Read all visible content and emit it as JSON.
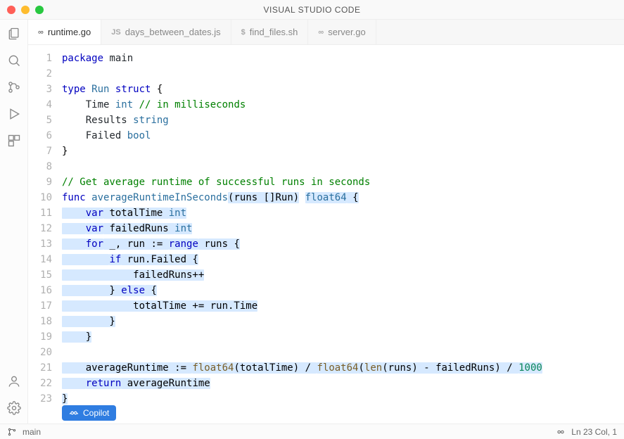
{
  "title": "VISUAL STUDIO CODE",
  "tabs": [
    {
      "icon": "go",
      "label": "runtime.go",
      "active": true
    },
    {
      "icon": "js",
      "label": "days_between_dates.js",
      "active": false
    },
    {
      "icon": "sh",
      "label": "find_files.sh",
      "active": false
    },
    {
      "icon": "go",
      "label": "server.go",
      "active": false
    }
  ],
  "tab_icon_text": {
    "go": "∞",
    "js": "JS",
    "sh": "$"
  },
  "code": {
    "lines": 23,
    "content": [
      {
        "n": 1,
        "tokens": [
          {
            "t": "package",
            "c": "k"
          },
          {
            "t": " "
          },
          {
            "t": "main",
            "c": "ident"
          }
        ]
      },
      {
        "n": 2,
        "tokens": []
      },
      {
        "n": 3,
        "tokens": [
          {
            "t": "type",
            "c": "k"
          },
          {
            "t": " "
          },
          {
            "t": "Run",
            "c": "t"
          },
          {
            "t": " "
          },
          {
            "t": "struct",
            "c": "k"
          },
          {
            "t": " {"
          }
        ]
      },
      {
        "n": 4,
        "tokens": [
          {
            "t": "    "
          },
          {
            "t": "Time ",
            "c": "ident"
          },
          {
            "t": "int",
            "c": "t"
          },
          {
            "t": " "
          },
          {
            "t": "// in milliseconds",
            "c": "c"
          }
        ]
      },
      {
        "n": 5,
        "tokens": [
          {
            "t": "    "
          },
          {
            "t": "Results ",
            "c": "ident"
          },
          {
            "t": "string",
            "c": "t"
          }
        ]
      },
      {
        "n": 6,
        "tokens": [
          {
            "t": "    "
          },
          {
            "t": "Failed ",
            "c": "ident"
          },
          {
            "t": "bool",
            "c": "t"
          }
        ]
      },
      {
        "n": 7,
        "tokens": [
          {
            "t": "}"
          }
        ]
      },
      {
        "n": 8,
        "tokens": []
      },
      {
        "n": 9,
        "tokens": [
          {
            "t": "// Get average runtime of successful runs in seconds",
            "c": "c"
          }
        ]
      },
      {
        "n": 10,
        "tokens": [
          {
            "t": "func",
            "c": "k"
          },
          {
            "t": " "
          },
          {
            "t": "averageRuntimeInSeconds",
            "c": "fn"
          },
          {
            "t": "(runs []Run)",
            "h": true
          },
          {
            "t": " "
          },
          {
            "t": "float64",
            "c": "t",
            "h": true
          },
          {
            "t": " {",
            "h": true
          }
        ]
      },
      {
        "n": 11,
        "tokens": [
          {
            "t": "    ",
            "h": true
          },
          {
            "t": "var",
            "c": "k",
            "h": true
          },
          {
            "t": " totalTime ",
            "h": true
          },
          {
            "t": "int",
            "c": "t",
            "h": true
          }
        ]
      },
      {
        "n": 12,
        "tokens": [
          {
            "t": "    ",
            "h": true
          },
          {
            "t": "var",
            "c": "k",
            "h": true
          },
          {
            "t": " failedRuns ",
            "h": true
          },
          {
            "t": "int",
            "c": "t",
            "h": true
          }
        ]
      },
      {
        "n": 13,
        "tokens": [
          {
            "t": "    ",
            "h": true
          },
          {
            "t": "for",
            "c": "k",
            "h": true
          },
          {
            "t": " _, run := ",
            "h": true
          },
          {
            "t": "range",
            "c": "k",
            "h": true
          },
          {
            "t": " runs {",
            "h": true
          }
        ]
      },
      {
        "n": 14,
        "tokens": [
          {
            "t": "        ",
            "h": true
          },
          {
            "t": "if",
            "c": "k",
            "h": true
          },
          {
            "t": " run.Failed {",
            "h": true
          }
        ]
      },
      {
        "n": 15,
        "tokens": [
          {
            "t": "            failedRuns++",
            "h": true
          }
        ]
      },
      {
        "n": 16,
        "tokens": [
          {
            "t": "        } ",
            "h": true
          },
          {
            "t": "else",
            "c": "k",
            "h": true
          },
          {
            "t": " {",
            "h": true
          }
        ]
      },
      {
        "n": 17,
        "tokens": [
          {
            "t": "            totalTime += run.Time",
            "h": true
          }
        ]
      },
      {
        "n": 18,
        "tokens": [
          {
            "t": "        }",
            "h": true
          }
        ]
      },
      {
        "n": 19,
        "tokens": [
          {
            "t": "    }",
            "h": true
          }
        ]
      },
      {
        "n": 20,
        "tokens": []
      },
      {
        "n": 21,
        "tokens": [
          {
            "t": "    averageRuntime := ",
            "h": true
          },
          {
            "t": "float64",
            "c": "f",
            "h": true
          },
          {
            "t": "(totalTime) / ",
            "h": true
          },
          {
            "t": "float64",
            "c": "f",
            "h": true
          },
          {
            "t": "(",
            "h": true
          },
          {
            "t": "len",
            "c": "f",
            "h": true
          },
          {
            "t": "(runs) - failedRuns) / ",
            "h": true
          },
          {
            "t": "1000",
            "c": "n",
            "h": true
          }
        ]
      },
      {
        "n": 22,
        "tokens": [
          {
            "t": "    ",
            "h": true
          },
          {
            "t": "return",
            "c": "k",
            "h": true
          },
          {
            "t": " averageRuntime",
            "h": true
          }
        ]
      },
      {
        "n": 23,
        "tokens": [
          {
            "t": "}",
            "h": true
          }
        ]
      }
    ]
  },
  "copilot_label": "Copilot",
  "status": {
    "branch": "main",
    "cursor": "Ln 23 Col, 1"
  }
}
